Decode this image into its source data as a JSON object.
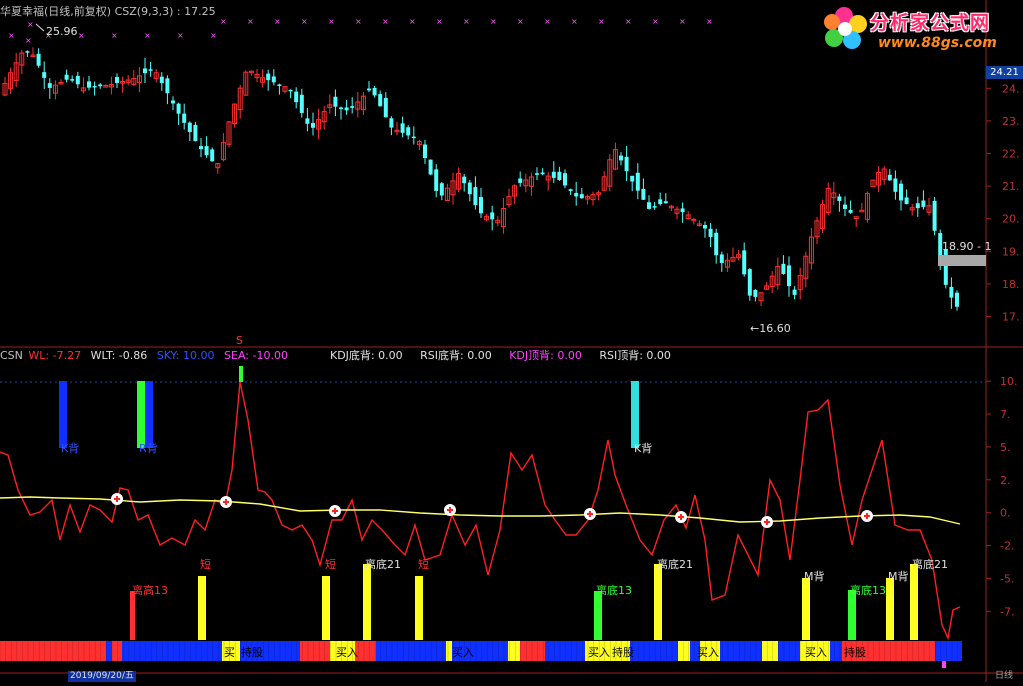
{
  "header": {
    "title": "华夏幸福(日线,前复权)",
    "indicator": "CSZ(9,3,3)",
    "indicator_value": ": 17.25"
  },
  "logo": {
    "text": "分析家公式网",
    "url": "www.88gs.com"
  },
  "price_axis": {
    "ticks": [
      "24.",
      "23.",
      "22.",
      "21.",
      "20.",
      "19.",
      "18.",
      "17."
    ],
    "last_price": "24.21"
  },
  "price_annotations": {
    "high": "25.96",
    "low": "←16.60",
    "current": "18.90 - 1"
  },
  "indicator_header": {
    "name": "CSN",
    "wl_label": "WL: -7.27",
    "wlt_label": "WLT: -0.86",
    "sky_label": "SKY: 10.00",
    "sea_label": "SEA: -10.00",
    "kdj_bottom": "KDJ底背: 0.00",
    "rsi_bottom": "RSI底背: 0.00",
    "kdj_top": "KDJ顶背: 0.00",
    "rsi_top": "RSI顶背: 0.00"
  },
  "indicator_axis": {
    "ticks": [
      "10.",
      "7.",
      "5.",
      "2.",
      "0.",
      "-2.",
      "-5.",
      "-7."
    ]
  },
  "signal_labels": {
    "k_back": "K背",
    "r_back": "R背",
    "s_marker": "S",
    "high13": "离高13",
    "short": "短",
    "bottom21": "离底21",
    "bottom13": "离底13",
    "m_back": "M背",
    "buy": "买入",
    "buy_short": "买",
    "hold": "持股"
  },
  "footer": {
    "date": "2019/09/20/五",
    "right": "日线"
  },
  "colors": {
    "up": "#ff3030",
    "down": "#54ffff",
    "wl_line": "#ff2020",
    "wlt_line": "#ffff66",
    "blue": "#1030ff",
    "green": "#30ff30",
    "yellow": "#ffff20",
    "magenta": "#ff40ff",
    "cyan": "#30e0e0"
  }
}
